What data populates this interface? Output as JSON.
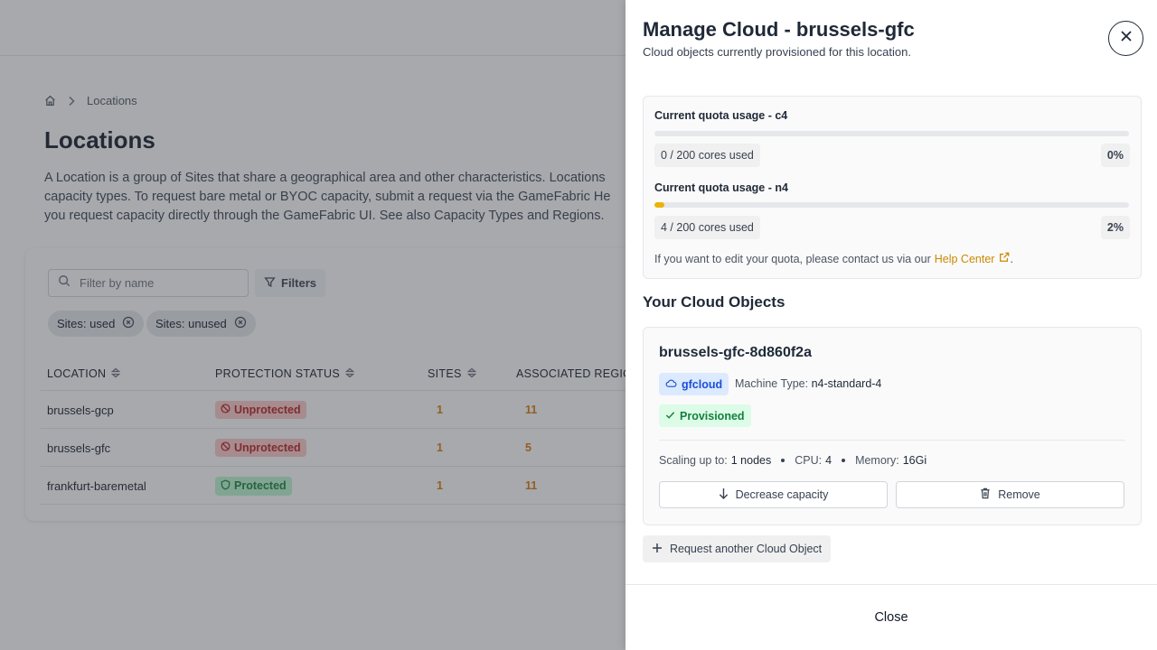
{
  "breadcrumb": {
    "home_icon": "home-icon",
    "current": "Locations"
  },
  "page": {
    "title": "Locations",
    "description_lines": [
      "A Location is a group of Sites that share a geographical area and other characteristics. Locations",
      "capacity types. To request bare metal or BYOC capacity, submit a request via the GameFabric He",
      "you request capacity directly through the GameFabric UI. See also Capacity Types and Regions."
    ]
  },
  "filters": {
    "search_placeholder": "Filter by name",
    "filters_label": "Filters",
    "chips": [
      "Sites: used",
      "Sites: unused"
    ]
  },
  "table": {
    "headers": [
      "LOCATION",
      "PROTECTION STATUS",
      "SITES",
      "ASSOCIATED REGION"
    ],
    "rows": [
      {
        "location": "brussels-gcp",
        "status": "Unprotected",
        "sites": "1",
        "regions": "11"
      },
      {
        "location": "brussels-gfc",
        "status": "Unprotected",
        "sites": "1",
        "regions": "5"
      },
      {
        "location": "frankfurt-baremetal",
        "status": "Protected",
        "sites": "1",
        "regions": "11"
      }
    ]
  },
  "drawer": {
    "title": "Manage Cloud - brussels-gfc",
    "subtitle": "Cloud objects currently provisioned for this location.",
    "quotas": [
      {
        "label": "Current quota usage - c4",
        "usage": "0 / 200 cores used",
        "percent": "0%",
        "fill": 0
      },
      {
        "label": "Current quota usage - n4",
        "usage": "4 / 200 cores used",
        "percent": "2%",
        "fill": 0.02
      }
    ],
    "quota_note": "If you want to edit your quota, please contact us via our",
    "help_link": "Help Center",
    "quota_note_end": ".",
    "section_title": "Your Cloud Objects",
    "object": {
      "name": "brussels-gfc-8d860f2a",
      "provider": "gfcloud",
      "machine_type_label": "Machine Type:",
      "machine_type": "n4-standard-4",
      "status": "Provisioned",
      "scaling_label": "Scaling up to:",
      "scaling_value": "1 nodes",
      "cpu_label": "CPU:",
      "cpu_value": "4",
      "memory_label": "Memory:",
      "memory_value": "16Gi",
      "decrease_label": "Decrease capacity",
      "remove_label": "Remove"
    },
    "request_label": "Request another Cloud Object",
    "close_label": "Close"
  },
  "colors": {
    "accent": "#ca8a04",
    "progress": "#eab308",
    "unprotected": "#b91c1c",
    "protected": "#15803d"
  }
}
